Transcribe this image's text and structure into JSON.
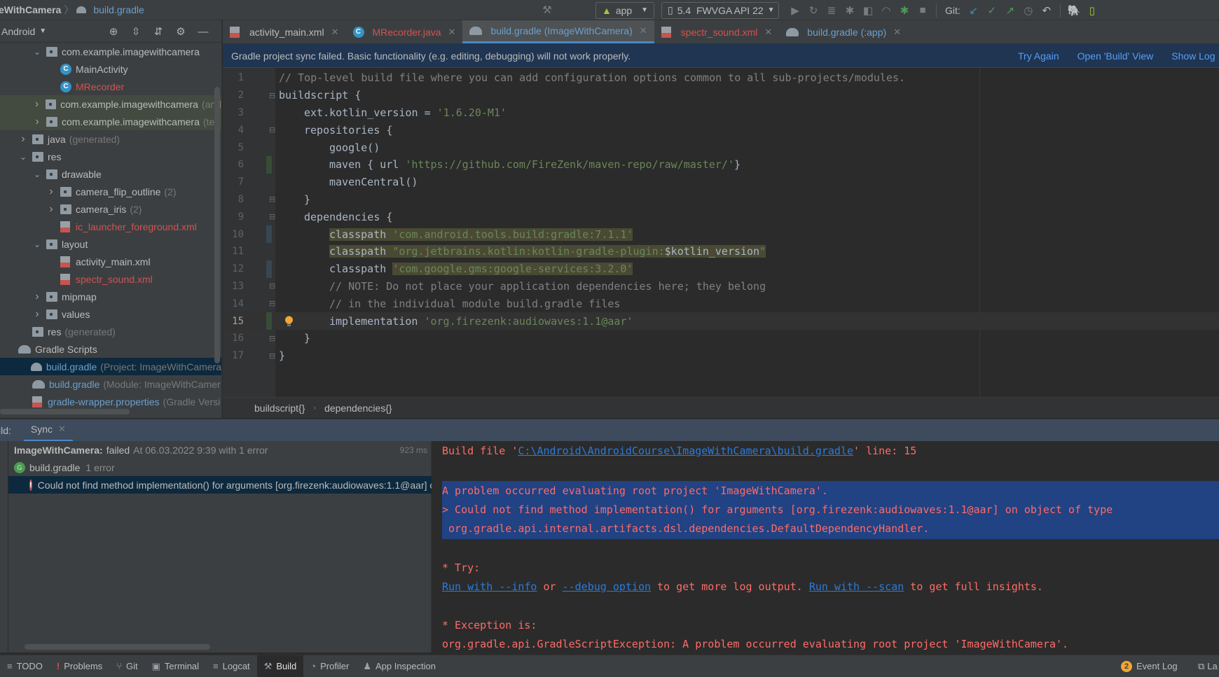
{
  "navbar": {
    "project": "eWithCamera",
    "file": "build.gradle",
    "run_config": "app",
    "device": "5.4  FWVGA API 22",
    "git_label": "Git:"
  },
  "sidebar": {
    "view": "Android",
    "items": [
      {
        "label": "com.example.imagewithcamera",
        "suffix": "",
        "kind": "folder",
        "color": "normal",
        "level": 2,
        "chevron": "down"
      },
      {
        "label": "MainActivity",
        "suffix": "",
        "kind": "class",
        "color": "normal",
        "level": 3,
        "chevron": ""
      },
      {
        "label": "MRecorder",
        "suffix": "",
        "kind": "class",
        "color": "red",
        "level": 3,
        "chevron": ""
      },
      {
        "label": "com.example.imagewithcamera",
        "suffix": "(and",
        "kind": "folder",
        "color": "normal",
        "level": 2,
        "chevron": "right"
      },
      {
        "label": "com.example.imagewithcamera",
        "suffix": "(tes",
        "kind": "folder",
        "color": "normal",
        "level": 2,
        "chevron": "right"
      },
      {
        "label": "java",
        "suffix": "(generated)",
        "kind": "folder",
        "color": "normal",
        "level": 1,
        "chevron": "right"
      },
      {
        "label": "res",
        "suffix": "",
        "kind": "folder",
        "color": "normal",
        "level": 1,
        "chevron": "down"
      },
      {
        "label": "drawable",
        "suffix": "",
        "kind": "folder",
        "color": "normal",
        "level": 2,
        "chevron": "down"
      },
      {
        "label": "camera_flip_outline",
        "suffix": "(2)",
        "kind": "folder",
        "color": "normal",
        "level": 3,
        "chevron": "right"
      },
      {
        "label": "camera_iris",
        "suffix": "(2)",
        "kind": "folder",
        "color": "normal",
        "level": 3,
        "chevron": "right"
      },
      {
        "label": "ic_launcher_foreground.xml",
        "suffix": "",
        "kind": "xml",
        "color": "red",
        "level": 3,
        "chevron": ""
      },
      {
        "label": "layout",
        "suffix": "",
        "kind": "folder",
        "color": "normal",
        "level": 2,
        "chevron": "down"
      },
      {
        "label": "activity_main.xml",
        "suffix": "",
        "kind": "xml",
        "color": "normal",
        "level": 3,
        "chevron": ""
      },
      {
        "label": "spectr_sound.xml",
        "suffix": "",
        "kind": "xml",
        "color": "red",
        "level": 3,
        "chevron": ""
      },
      {
        "label": "mipmap",
        "suffix": "",
        "kind": "folder",
        "color": "normal",
        "level": 2,
        "chevron": "right"
      },
      {
        "label": "values",
        "suffix": "",
        "kind": "folder",
        "color": "normal",
        "level": 2,
        "chevron": "right"
      },
      {
        "label": "res",
        "suffix": "(generated)",
        "kind": "folder",
        "color": "normal",
        "level": 1,
        "chevron": ""
      },
      {
        "label": "Gradle Scripts",
        "suffix": "",
        "kind": "gradle",
        "color": "normal",
        "level": 0,
        "chevron": ""
      },
      {
        "label": "build.gradle",
        "suffix": "(Project: ImageWithCamera",
        "kind": "gradle",
        "color": "blue",
        "level": 1,
        "chevron": "",
        "selected": true
      },
      {
        "label": "build.gradle",
        "suffix": "(Module: ImageWithCamer",
        "kind": "gradle",
        "color": "blue",
        "level": 1,
        "chevron": ""
      },
      {
        "label": "gradle-wrapper.properties",
        "suffix": "(Gradle Versi",
        "kind": "props",
        "color": "blue",
        "level": 1,
        "chevron": ""
      }
    ]
  },
  "tabs": [
    {
      "label": "activity_main.xml",
      "kind": "xml",
      "color": "normal",
      "active": false
    },
    {
      "label": "MRecorder.java",
      "kind": "class",
      "color": "red",
      "active": false
    },
    {
      "label": "build.gradle (ImageWithCamera)",
      "kind": "gradle",
      "color": "blue",
      "active": true
    },
    {
      "label": "spectr_sound.xml",
      "kind": "xml",
      "color": "red",
      "active": false
    },
    {
      "label": "build.gradle (:app)",
      "kind": "gradle",
      "color": "blue",
      "active": false
    }
  ],
  "banner": {
    "message": "Gradle project sync failed. Basic functionality (e.g. editing, debugging) will not work properly.",
    "try_again": "Try Again",
    "open_build": "Open 'Build' View",
    "show_log": "Show Log"
  },
  "editor": {
    "current_line": 15,
    "lines": [
      {
        "n": 1,
        "indent": 0,
        "parts": [
          {
            "t": "// Top-level build file where you can add configuration options common to all sub-projects/modules.",
            "c": "cm"
          }
        ]
      },
      {
        "n": 2,
        "indent": 0,
        "fold": "open",
        "parts": [
          {
            "t": "buildscript {",
            "c": ""
          }
        ]
      },
      {
        "n": 3,
        "indent": 1,
        "parts": [
          {
            "t": "ext.kotlin_version = ",
            "c": ""
          },
          {
            "t": "'1.6.20-M1'",
            "c": "str"
          }
        ]
      },
      {
        "n": 4,
        "indent": 1,
        "fold": "open",
        "parts": [
          {
            "t": "repositories {",
            "c": ""
          }
        ]
      },
      {
        "n": 5,
        "indent": 2,
        "parts": [
          {
            "t": "google()",
            "c": ""
          }
        ]
      },
      {
        "n": 6,
        "indent": 2,
        "change": "add",
        "parts": [
          {
            "t": "maven { url ",
            "c": ""
          },
          {
            "t": "'https://github.com/FireZenk/maven-repo/raw/master/'",
            "c": "str"
          },
          {
            "t": "}",
            "c": ""
          }
        ]
      },
      {
        "n": 7,
        "indent": 2,
        "parts": [
          {
            "t": "mavenCentral()",
            "c": ""
          }
        ]
      },
      {
        "n": 8,
        "indent": 1,
        "fold": "close",
        "parts": [
          {
            "t": "}",
            "c": ""
          }
        ]
      },
      {
        "n": 9,
        "indent": 1,
        "fold": "open",
        "parts": [
          {
            "t": "dependencies {",
            "c": ""
          }
        ]
      },
      {
        "n": 10,
        "indent": 2,
        "change": "mod",
        "parts": [
          {
            "t": "classpath ",
            "c": "hl"
          },
          {
            "t": "'com.android.tools.build:gradle:7.1.1'",
            "c": "str hl"
          }
        ]
      },
      {
        "n": 11,
        "indent": 2,
        "parts": [
          {
            "t": "classpath ",
            "c": "hl"
          },
          {
            "t": "\"org.jetbrains.kotlin:kotlin-gradle-plugin:",
            "c": "str hl"
          },
          {
            "t": "$kotlin_version",
            "c": "hl"
          },
          {
            "t": "\"",
            "c": "str hl"
          }
        ]
      },
      {
        "n": 12,
        "indent": 2,
        "change": "mod",
        "parts": [
          {
            "t": "classpath ",
            "c": ""
          },
          {
            "t": "'com.google.gms:google-services:3.2.0'",
            "c": "str hl"
          }
        ]
      },
      {
        "n": 13,
        "indent": 2,
        "fold": "open",
        "parts": [
          {
            "t": "// NOTE: Do not place your application dependencies here; they belong",
            "c": "cm"
          }
        ]
      },
      {
        "n": 14,
        "indent": 2,
        "fold": "close",
        "parts": [
          {
            "t": "// in the individual module build.gradle files",
            "c": "cm"
          }
        ]
      },
      {
        "n": 15,
        "indent": 2,
        "change": "add",
        "bulb": true,
        "parts": [
          {
            "t": "implementation ",
            "c": ""
          },
          {
            "t": "'org.firezenk:audiowaves:1.1@aar'",
            "c": "str"
          }
        ]
      },
      {
        "n": 16,
        "indent": 1,
        "fold": "close",
        "parts": [
          {
            "t": "}",
            "c": ""
          }
        ]
      },
      {
        "n": 17,
        "indent": 0,
        "fold": "close",
        "parts": [
          {
            "t": "}",
            "c": ""
          }
        ]
      }
    ],
    "breadcrumb": [
      "buildscript{}",
      "dependencies{}"
    ]
  },
  "build": {
    "label": "ild:",
    "tab": "Sync",
    "tree": {
      "project": "ImageWithCamera:",
      "status": "failed",
      "when": "At 06.03.2022 9:39 with 1 error",
      "duration": "923 ms",
      "file": "build.gradle",
      "file_errors": "1 error",
      "error": "Could not find method implementation() for arguments [org.firezenk:audiowaves:1.1@aar] on object of type org.gradle.api.internal.artifacts.dsl.dependencies.DefaultDependencyHandler."
    },
    "console": {
      "build_file_prefix": "Build file '",
      "build_file_link": "C:\\Android\\AndroidCourse\\ImageWithCamera\\build.gradle",
      "build_file_suffix": "' line: 15",
      "problem": "A problem occurred evaluating root project 'ImageWithCamera'.",
      "cause": "> Could not find method implementation() for arguments [org.firezenk:audiowaves:1.1@aar] on object of type",
      "cause2": " org.gradle.api.internal.artifacts.dsl.dependencies.DefaultDependencyHandler.",
      "try": "* Try:",
      "run_info": "Run with --info",
      "or": " or ",
      "debug": "--debug option",
      "more_log": " to get more log output. ",
      "run_scan": "Run with --scan",
      "insights": " to get full insights.",
      "exception": "* Exception is:",
      "exception_line": "org.gradle.api.GradleScriptException: A problem occurred evaluating root project 'ImageWithCamera'."
    }
  },
  "bottom": {
    "buttons": [
      {
        "label": "TODO",
        "icon": "≡",
        "name": "todo"
      },
      {
        "label": "Problems",
        "icon": "!",
        "name": "problems"
      },
      {
        "label": "Git",
        "icon": "⑂",
        "name": "git"
      },
      {
        "label": "Terminal",
        "icon": "▣",
        "name": "terminal"
      },
      {
        "label": "Logcat",
        "icon": "≡",
        "name": "logcat"
      },
      {
        "label": "Build",
        "icon": "⚒",
        "name": "build",
        "active": true
      },
      {
        "label": "Profiler",
        "icon": "◔",
        "name": "profiler"
      },
      {
        "label": "App Inspection",
        "icon": "♟",
        "name": "app-inspection"
      }
    ],
    "event_count": "2",
    "event_log": "Event Log",
    "layout_inspector": "La"
  }
}
